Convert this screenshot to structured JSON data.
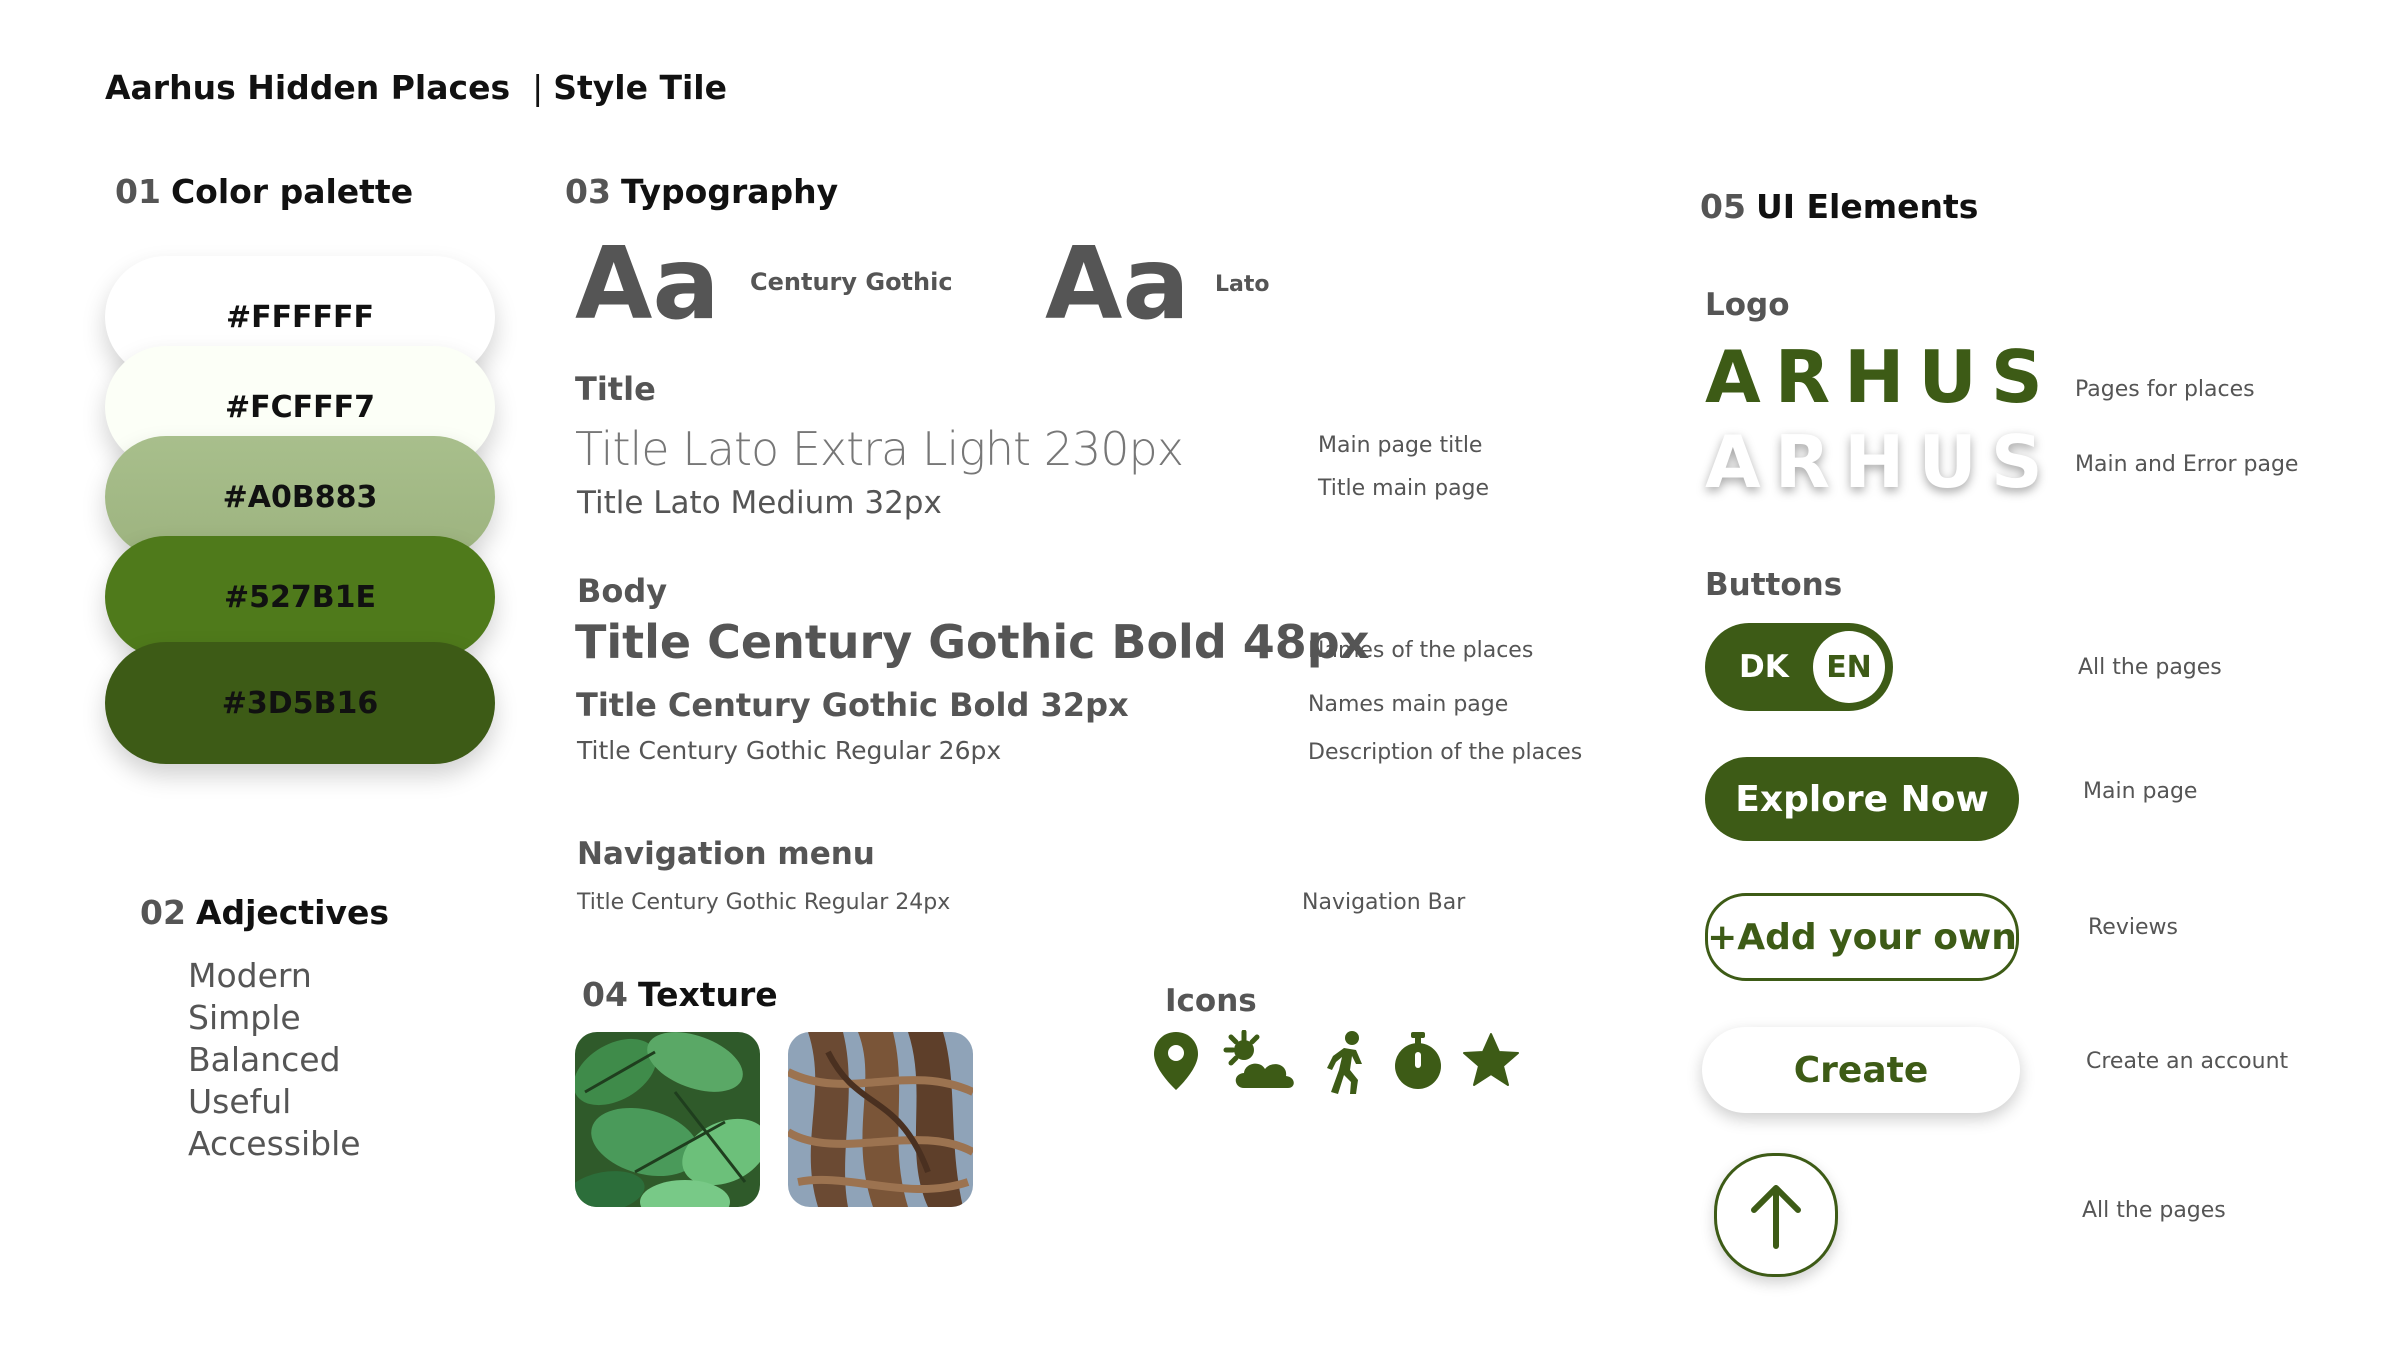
{
  "header": {
    "title": "Aarhus Hidden Places",
    "separator": "|",
    "subtitle": "Style Tile"
  },
  "palette": {
    "number": "01",
    "title": "Color palette",
    "colors": [
      {
        "hex": "#FFFFFF"
      },
      {
        "hex": "#FCFFF7"
      },
      {
        "hex": "#A0B883"
      },
      {
        "hex": "#527B1E"
      },
      {
        "hex": "#3D5B16"
      }
    ]
  },
  "adjectives": {
    "number": "02",
    "title": "Adjectives",
    "items": [
      "Modern",
      "Simple",
      "Balanced",
      "Useful",
      "Accessible"
    ]
  },
  "typography": {
    "number": "03",
    "title": "Typography",
    "specimens": [
      {
        "glyph": "Aa",
        "font": "Century Gothic"
      },
      {
        "glyph": "Aa",
        "font": "Lato"
      }
    ],
    "title_group": {
      "label": "Title",
      "rows": [
        {
          "text": "Title Lato Extra Light 230px",
          "usage": "Main page title"
        },
        {
          "text": "Title Lato Medium 32px",
          "usage": "Title main page"
        }
      ]
    },
    "body_group": {
      "label": "Body",
      "rows": [
        {
          "text": "Title Century Gothic Bold 48px",
          "usage": "Names of the places"
        },
        {
          "text": "Title Century Gothic Bold 32px",
          "usage": "Names main page"
        },
        {
          "text": "Title Century Gothic Regular 26px",
          "usage": "Description of the places"
        }
      ]
    },
    "nav_group": {
      "label": "Navigation menu",
      "rows": [
        {
          "text": "Title Century Gothic Regular 24px",
          "usage": "Navigation Bar"
        }
      ]
    }
  },
  "texture": {
    "number": "04",
    "title": "Texture"
  },
  "icons": {
    "title": "Icons",
    "items": [
      "map-pin-icon",
      "sun-cloud-icon",
      "walking-person-icon",
      "stopwatch-icon",
      "star-icon"
    ]
  },
  "ui_elements": {
    "number": "05",
    "title": "UI Elements",
    "logo": {
      "label": "Logo",
      "wordmark": "ARHUS",
      "variants": [
        {
          "usage": "Pages for places"
        },
        {
          "usage": "Main and Error page"
        }
      ]
    },
    "buttons": {
      "label": "Buttons",
      "toggle": {
        "left": "DK",
        "right": "EN",
        "usage": "All the pages"
      },
      "explore": {
        "label": "Explore Now",
        "usage": "Main page"
      },
      "add": {
        "label": "+Add your own",
        "usage": "Reviews"
      },
      "create": {
        "label": "Create",
        "usage": "Create an account"
      },
      "scroll_top": {
        "icon": "arrow-up-icon",
        "usage": "All the pages"
      }
    }
  },
  "colors": {
    "primary": "#3D5B16",
    "mid": "#527B1E",
    "light": "#A0B883",
    "offwhite": "#FCFFF7",
    "white": "#FFFFFF",
    "text_grey": "#555555"
  }
}
